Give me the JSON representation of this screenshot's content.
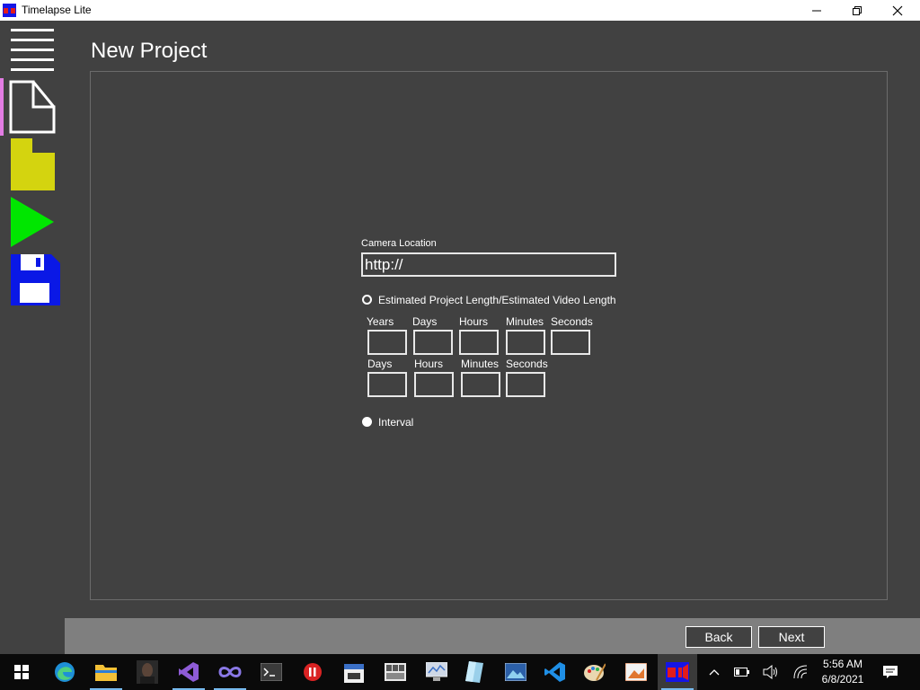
{
  "window": {
    "title": "Timelapse Lite",
    "controls": [
      "minimize",
      "restore",
      "close"
    ]
  },
  "sidebar": {
    "items": [
      {
        "name": "menu",
        "icon": "hamburger-menu-icon"
      },
      {
        "name": "new-project",
        "icon": "new-document-icon",
        "active": true
      },
      {
        "name": "open-project",
        "icon": "folder-icon",
        "color": "#d4d40f"
      },
      {
        "name": "run",
        "icon": "play-icon",
        "color": "#00e600"
      },
      {
        "name": "save",
        "icon": "save-disk-icon",
        "color": "#0a18e6"
      }
    ],
    "accent_color": "#e27ce3"
  },
  "page": {
    "title": "New Project"
  },
  "form": {
    "camera_location_label": "Camera Location",
    "camera_location_value": "http://",
    "option_length": {
      "label": "Estimated Project Length/Estimated Video Length",
      "selected": false
    },
    "project_length": {
      "labels": [
        "Years",
        "Days",
        "Hours",
        "Minutes",
        "Seconds"
      ],
      "values": [
        "",
        "",
        "",
        "",
        ""
      ]
    },
    "video_length": {
      "labels": [
        "Days",
        "Hours",
        "Minutes",
        "Seconds"
      ],
      "values": [
        "",
        "",
        "",
        ""
      ]
    },
    "option_interval": {
      "label": "Interval",
      "selected": true
    }
  },
  "buttons": {
    "back": "Back",
    "next": "Next"
  },
  "taskbar": {
    "apps": [
      "start-icon",
      "edge-icon",
      "file-explorer-icon",
      "photo-icon",
      "visual-studio-icon",
      "infinity-app-icon",
      "terminal-icon",
      "red-circle-app-icon",
      "calendar-app-icon",
      "grid-app-icon",
      "monitor-app-icon",
      "glass-app-icon",
      "picture-app-icon",
      "vscode-icon",
      "paint-palette-icon",
      "image-viewer-icon",
      "timelapse-lite-icon"
    ],
    "time": "5:56 AM",
    "date": "6/8/2021"
  },
  "colors": {
    "background": "#414141",
    "bottom_bar": "#7f7f7f",
    "taskbar": "#0a0a0a"
  }
}
